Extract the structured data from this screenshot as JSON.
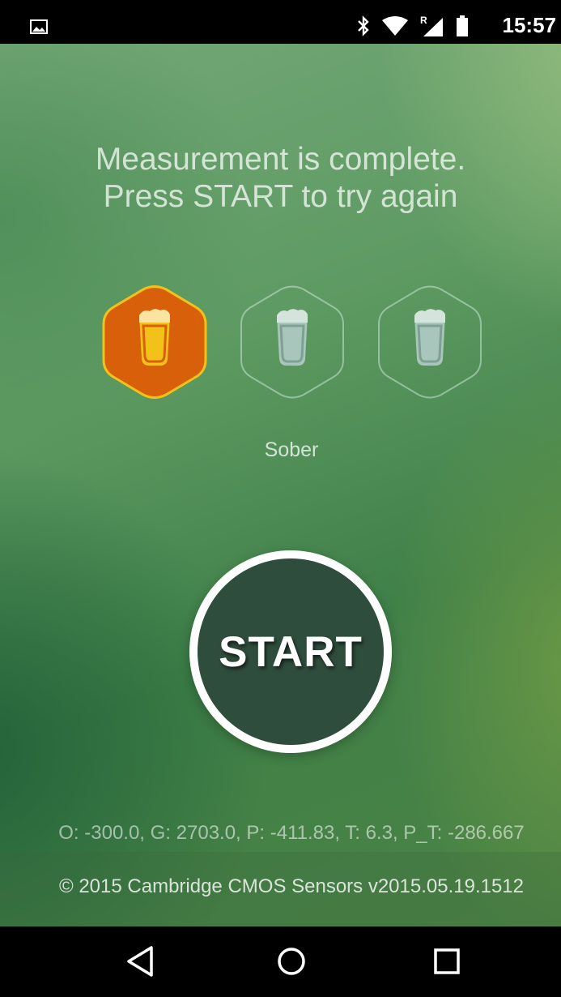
{
  "status_bar": {
    "time": "15:57",
    "icons": [
      "image-notification-icon",
      "bluetooth-icon",
      "wifi-icon",
      "roaming-signal-icon",
      "battery-icon"
    ],
    "roaming_label": "R"
  },
  "main": {
    "headline_line1": "Measurement is complete.",
    "headline_line2": "Press START to try again",
    "levels": [
      {
        "name": "beer-glass-icon",
        "active": true
      },
      {
        "name": "beer-glass-icon",
        "active": false
      },
      {
        "name": "beer-glass-icon",
        "active": false
      }
    ],
    "level_label": "Sober",
    "start_label": "START",
    "readings": "O: -300.0, G: 2703.0, P: -411.83, T: 6.3, P_T: -286.667",
    "copyright": "© 2015 Cambridge CMOS Sensors v2015.05.19.1512"
  },
  "colors": {
    "active_hex_fill": "#d9600b",
    "active_hex_border": "#f2c21a",
    "beer_fill": "#f2c21a",
    "inactive_glass": "#a8c6bb",
    "start_button_fill": "#2f4d3c"
  },
  "nav_bar": {
    "buttons": [
      "back-icon",
      "home-icon",
      "recents-icon"
    ]
  }
}
